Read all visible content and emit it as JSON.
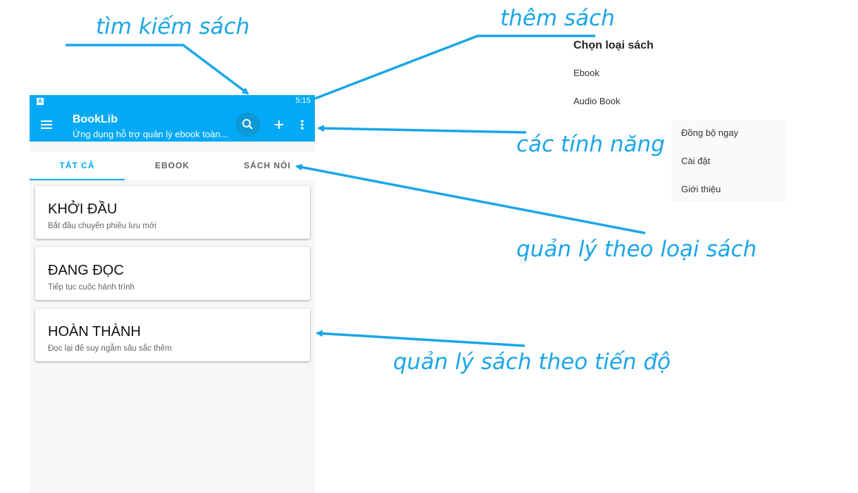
{
  "status_bar": {
    "notification_icon": "A",
    "time": "5:15"
  },
  "app_bar": {
    "title": "BookLib",
    "subtitle": "Ứng dụng hỗ trợ quản lý ebook toàn...",
    "icons": [
      "menu-icon",
      "search-icon",
      "add-icon",
      "more-vert-icon"
    ]
  },
  "tabs": [
    {
      "label": "TẤT CẢ",
      "active": true
    },
    {
      "label": "EBOOK",
      "active": false
    },
    {
      "label": "SÁCH NÓI",
      "active": false
    }
  ],
  "cards": [
    {
      "title": "KHỞI ĐẦU",
      "subtitle": "Bắt đầu chuyến phiêu lưu mới"
    },
    {
      "title": "ĐANG ĐỌC",
      "subtitle": "Tiếp tục cuộc hành trình"
    },
    {
      "title": "HOÀN THÀNH",
      "subtitle": "Đọc lại để suy ngẫm sâu sắc thêm"
    }
  ],
  "add_menu": {
    "heading": "Chọn loại sách",
    "items": [
      "Ebook",
      "Audio Book"
    ]
  },
  "overflow_menu": {
    "items": [
      "Đồng bộ ngay",
      "Cài đặt",
      "Giới thiệu"
    ]
  },
  "annotations": {
    "search": "tìm kiếm sách",
    "add": "thêm sách",
    "features": "các tính năng",
    "type": "quản lý theo loại sách",
    "progress": "quản  lý sách theo tiến độ"
  },
  "colors": {
    "primary": "#03a9f4",
    "annotation": "#1aa6e8",
    "tab_active": "#03a9f4",
    "tab_inactive": "#616161"
  }
}
